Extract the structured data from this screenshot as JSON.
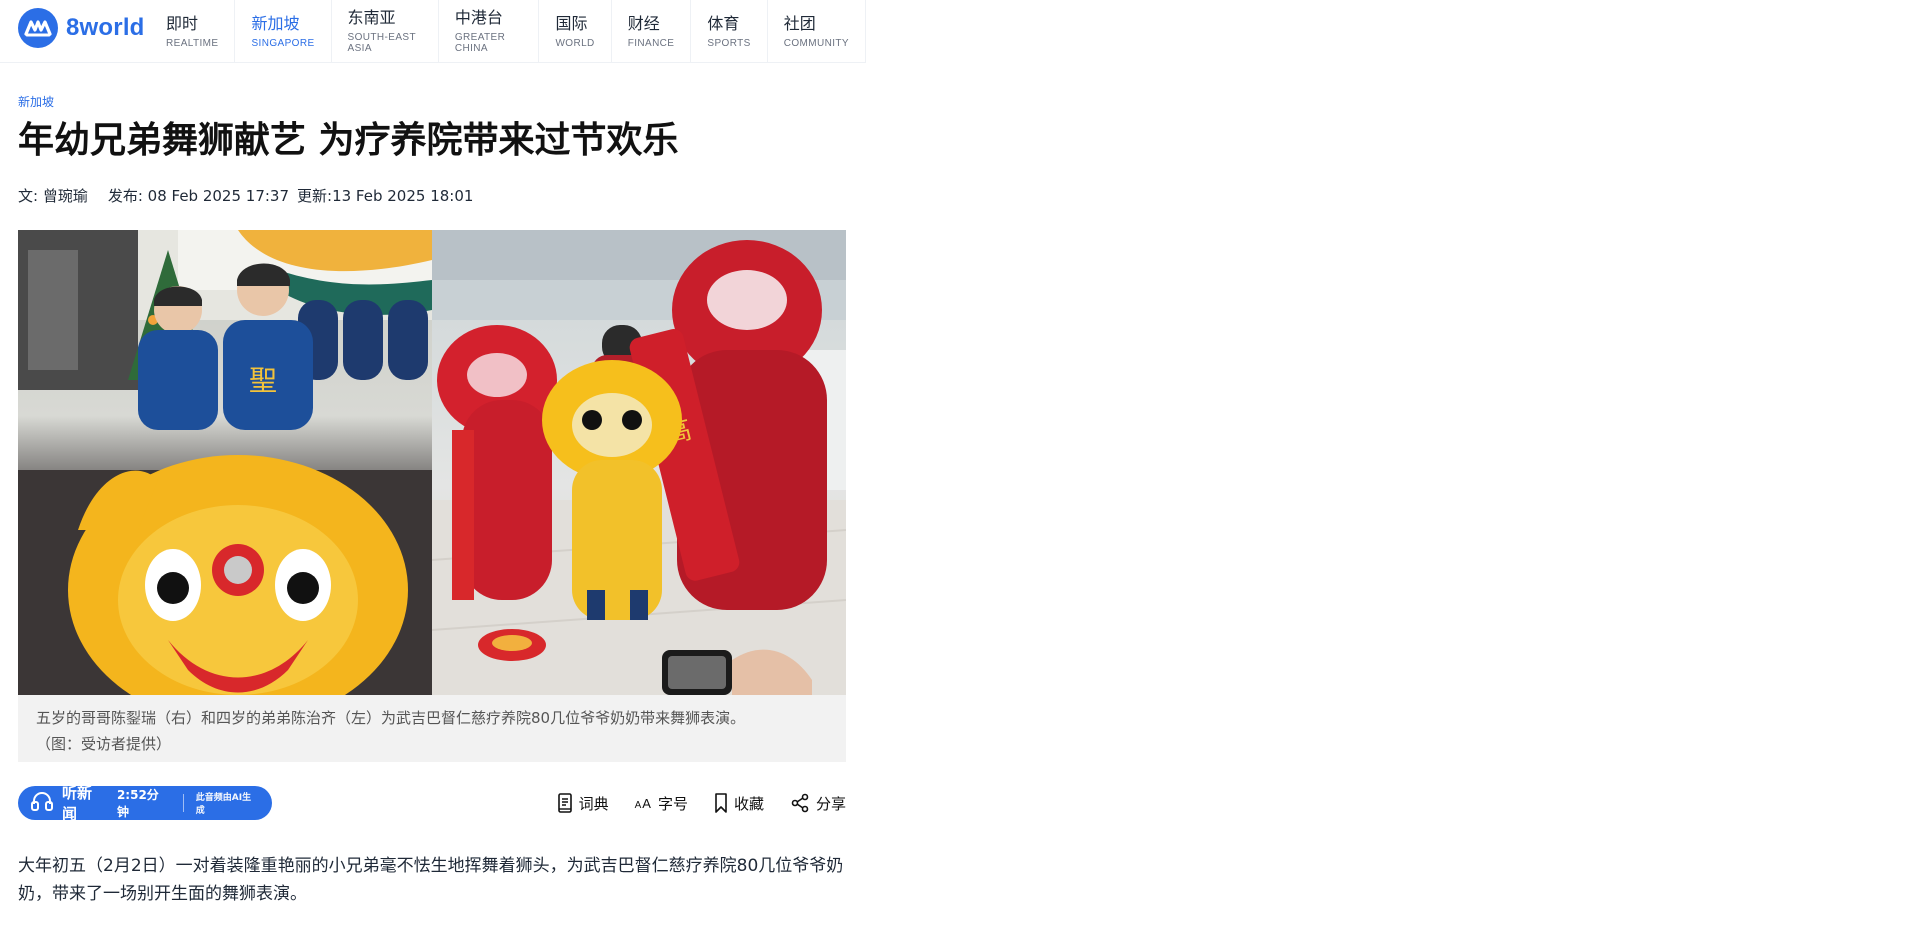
{
  "brand": {
    "name": "8world",
    "accent": "#2b6ee6"
  },
  "nav": [
    {
      "zh": "即时",
      "en": "REALTIME",
      "active": false
    },
    {
      "zh": "新加坡",
      "en": "SINGAPORE",
      "active": true
    },
    {
      "zh": "东南亚",
      "en": "SOUTH-EAST ASIA",
      "active": false
    },
    {
      "zh": "中港台",
      "en": "GREATER CHINA",
      "active": false
    },
    {
      "zh": "国际",
      "en": "WORLD",
      "active": false
    },
    {
      "zh": "财经",
      "en": "FINANCE",
      "active": false
    },
    {
      "zh": "体育",
      "en": "SPORTS",
      "active": false
    },
    {
      "zh": "社团",
      "en": "COMMUNITY",
      "active": false
    }
  ],
  "article": {
    "category": "新加坡",
    "title": "年幼兄弟舞狮献艺 为疗养院带来过节欢乐",
    "author": "文: 曾琬瑜",
    "published": "发布: 08 Feb 2025 17:37",
    "updated": "更新:13 Feb 2025 18:01",
    "caption_line1": "五岁的哥哥陈銐瑞（右）和四岁的弟弟陈治齐（左）为武吉巴督仁慈疗养院80几位爷爷奶奶带来舞狮表演。",
    "caption_line2": "（图：受访者提供）",
    "paragraph": "大年初五（2月2日）一对着装隆重艳丽的小兄弟毫不怯生地挥舞着狮头，为武吉巴督仁慈疗养院80几位爷爷奶奶，带来了一场别开生面的舞狮表演。"
  },
  "listen": {
    "label": "听新闻",
    "duration": "2:52分钟",
    "ai_note": "此音频由AI生成"
  },
  "tools": {
    "dictionary": "词典",
    "font_size": "字号",
    "font_size_icon_text": "AA",
    "bookmark": "收藏",
    "share": "分享"
  },
  "icons": {
    "logo": "brand-logo-icon",
    "headphones": "headphones-icon",
    "dictionary": "book-icon",
    "font_size": "font-size-icon",
    "bookmark": "bookmark-icon",
    "share": "share-icon"
  }
}
